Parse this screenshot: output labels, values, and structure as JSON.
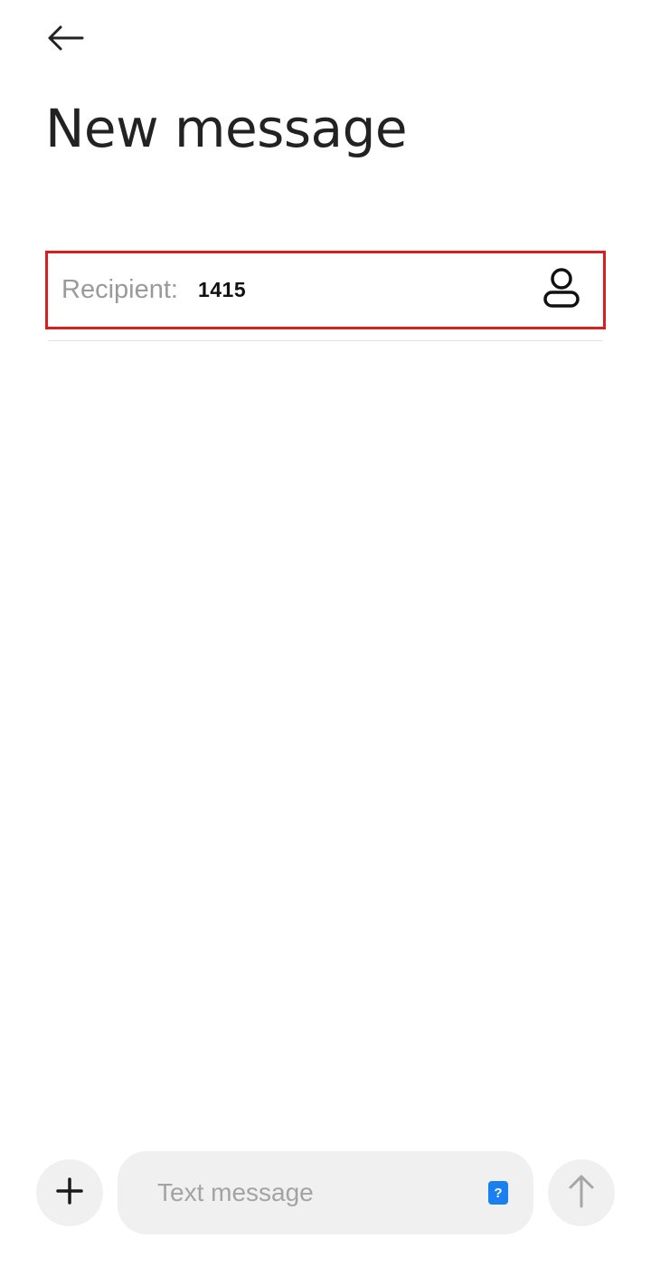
{
  "header": {
    "title": "New message",
    "back_icon": "arrow-left-icon"
  },
  "recipient": {
    "label": "Recipient:",
    "value": "1415",
    "contact_icon": "contact-person-icon",
    "highlight_color": "#d91e1e"
  },
  "composer": {
    "placeholder": "Text message",
    "sim_badge": "?",
    "sim_badge_color": "#1a7ff0",
    "add_icon": "plus-icon",
    "send_icon": "arrow-up-icon"
  }
}
